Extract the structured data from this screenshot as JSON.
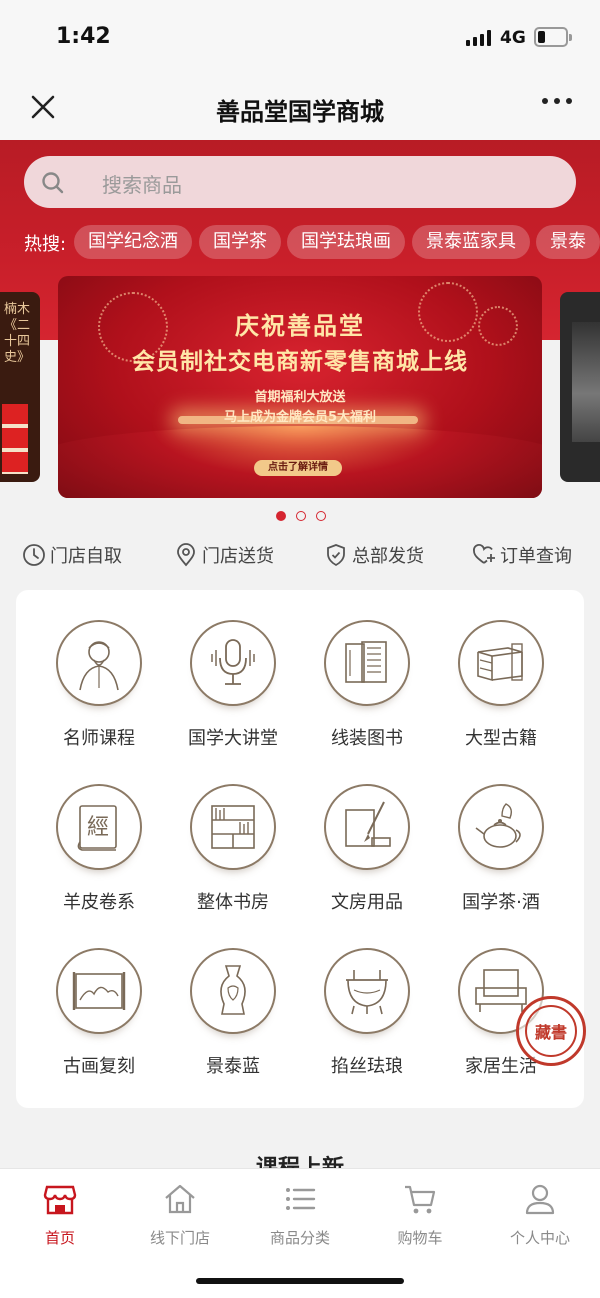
{
  "status_bar": {
    "time": "1:42",
    "network": "4G"
  },
  "navbar": {
    "title": "善品堂国学商城"
  },
  "search": {
    "placeholder": "搜索商品"
  },
  "hot_search": {
    "label": "热搜:",
    "tags": [
      "国学纪念酒",
      "国学茶",
      "国学珐琅画",
      "景泰蓝家具",
      "景泰"
    ]
  },
  "banner": {
    "line1": "庆祝善品堂",
    "line2": "会员制社交电商新零售商城上线",
    "sub1": "首期福利大放送",
    "sub2": "马上成为金牌会员5大福利",
    "button": "点击了解详情",
    "side_left_text": "楠木《二十四史》",
    "active_dot": 0,
    "dot_count": 3
  },
  "services": [
    {
      "label": "门店自取",
      "icon": "clock-icon"
    },
    {
      "label": "门店送货",
      "icon": "location-pin-icon"
    },
    {
      "label": "总部发货",
      "icon": "shield-icon"
    },
    {
      "label": "订单查询",
      "icon": "heart-plus-icon"
    }
  ],
  "categories": [
    {
      "label": "名师课程",
      "icon": "teacher-portrait-icon"
    },
    {
      "label": "国学大讲堂",
      "icon": "microphone-icon"
    },
    {
      "label": "线装图书",
      "icon": "bound-books-icon"
    },
    {
      "label": "大型古籍",
      "icon": "book-stack-icon"
    },
    {
      "label": "羊皮卷系",
      "icon": "scroll-classic-icon"
    },
    {
      "label": "整体书房",
      "icon": "bookshelf-icon"
    },
    {
      "label": "文房用品",
      "icon": "brush-ink-icon"
    },
    {
      "label": "国学茶·酒",
      "icon": "teapot-icon"
    },
    {
      "label": "古画复刻",
      "icon": "painting-scroll-icon"
    },
    {
      "label": "景泰蓝",
      "icon": "vase-icon"
    },
    {
      "label": "掐丝珐琅",
      "icon": "bronze-vessel-icon"
    },
    {
      "label": "家居生活",
      "icon": "armchair-icon"
    }
  ],
  "seal_text": "藏書",
  "section_title": "课程上新",
  "tabbar": [
    {
      "label": "首页",
      "icon": "shop-icon",
      "active": true
    },
    {
      "label": "线下门店",
      "icon": "home-icon",
      "active": false
    },
    {
      "label": "商品分类",
      "icon": "list-icon",
      "active": false
    },
    {
      "label": "购物车",
      "icon": "cart-icon",
      "active": false
    },
    {
      "label": "个人中心",
      "icon": "user-icon",
      "active": false
    }
  ],
  "colors": {
    "brand_red": "#c7161e",
    "icon_brown": "#8c7a66"
  }
}
